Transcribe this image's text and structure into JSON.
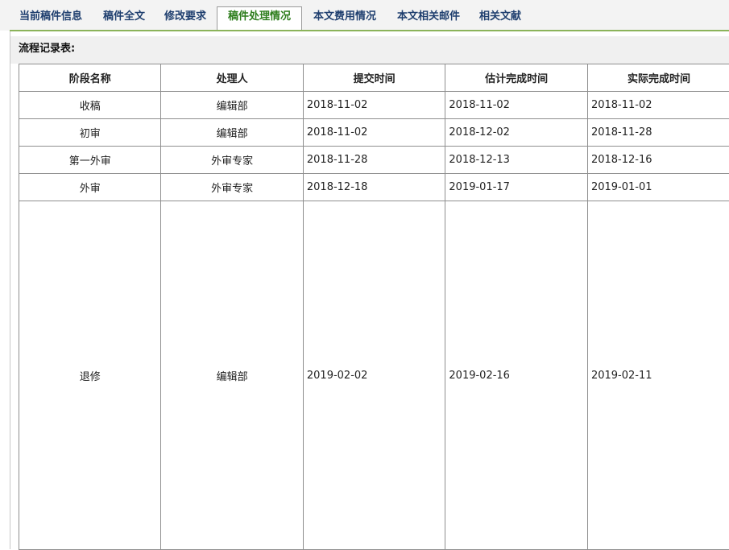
{
  "tabs": [
    {
      "label": "当前稿件信息"
    },
    {
      "label": "稿件全文"
    },
    {
      "label": "修改要求"
    },
    {
      "label": "稿件处理情况"
    },
    {
      "label": "本文费用情况"
    },
    {
      "label": "本文相关邮件"
    },
    {
      "label": "相关文献"
    }
  ],
  "active_tab": "稿件处理情况",
  "section": {
    "title": "流程记录表:"
  },
  "table": {
    "headers": [
      "阶段名称",
      "处理人",
      "提交时间",
      "估计完成时间",
      "实际完成时间"
    ],
    "rows": [
      [
        "收稿",
        "编辑部",
        "2018-11-02",
        "2018-11-02",
        "2018-11-02"
      ],
      [
        "初审",
        "编辑部",
        "2018-11-02",
        "2018-12-02",
        "2018-11-28"
      ],
      [
        "第一外审",
        "外审专家",
        "2018-11-28",
        "2018-12-13",
        "2018-12-16"
      ],
      [
        "外审",
        "外审专家",
        "2018-12-18",
        "2019-01-17",
        "2019-01-01"
      ],
      [
        "退修",
        "编辑部",
        "2019-02-02",
        "2019-02-16",
        "2019-02-11"
      ]
    ]
  },
  "colors": {
    "active_tab_text": "#2d7d1c",
    "tab_text": "#1f3f6f",
    "tab_underline": "#8bb35a"
  }
}
